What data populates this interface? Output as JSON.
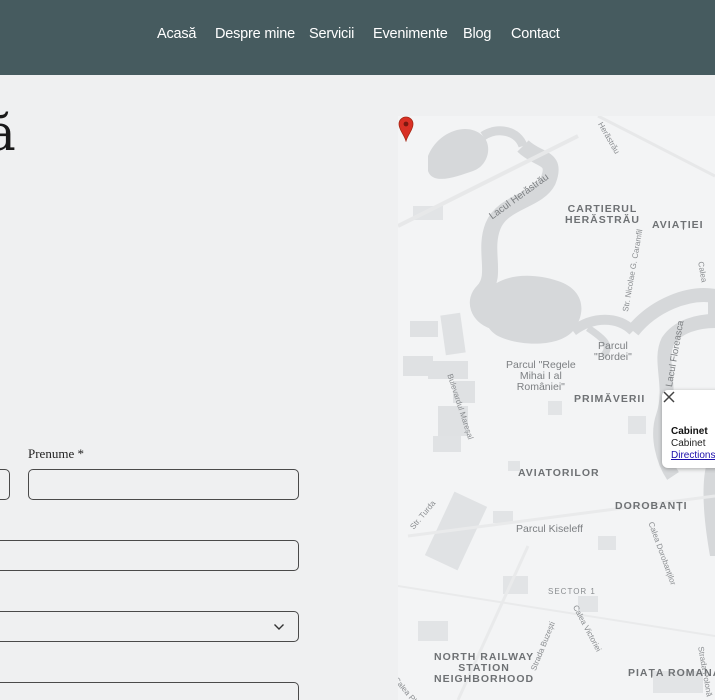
{
  "nav": {
    "items": [
      {
        "label": "Acasă"
      },
      {
        "label": "Despre mine"
      },
      {
        "label": "Servicii"
      },
      {
        "label": "Evenimente"
      },
      {
        "label": "Blog"
      },
      {
        "label": "Contact"
      }
    ]
  },
  "heading": {
    "visible_fragment": "ă"
  },
  "form": {
    "prenume_label": "Prenume *",
    "prenume_value": "",
    "select_chevron_icon": "chevron-down-icon"
  },
  "map": {
    "labels": {
      "cartierul": "CARTIERUL\nHERĂSTRĂU",
      "aviatiei": "AVIAȚIEI",
      "lacul_herastrau": "Lacul Herăstrău",
      "parcul_bordei": "Parcul\n\"Bordei\"",
      "parcul_regele": "Parcul \"Regele\nMihai I al\nRomâniei\"",
      "primaverii": "PRIMĂVERII",
      "aviatorilor": "AVIATORILOR",
      "dorobanti": "DOROBANȚI",
      "parcul_kiseleff": "Parcul Kiseleff",
      "sector1": "SECTOR 1",
      "north_railway": "NORTH RAILWAY\nSTATION\nNEIGHBORHOOD",
      "piata_romana": "PIAȚA ROMANA",
      "str_turda": "Str. Turda",
      "lacul_floreasca": "Lacul Floreasca",
      "str_caramfil": "Str. Nicolae G. Caramfil",
      "bd_maresal": "Bulevardul Mareșal",
      "calea_dorobantilor": "Calea Dorobanților",
      "calea_victoriei": "Calea Victoriei",
      "strada_buzesti": "Strada Buzești",
      "strada_polona": "Strada Polonă",
      "calea_plevnei": "Calea Plevnei",
      "calea": "Calea",
      "herastrau_top": "Herăstrău"
    },
    "popup": {
      "title": "Cabinet",
      "subtitle": "Cabinet",
      "link": "Directions",
      "close_icon": "close-icon"
    },
    "pin_icon": "map-pin-icon",
    "colors": {
      "water": "#d6d8da",
      "land": "#f3f4f5",
      "buildings": "#dfe1e3",
      "pin": "#d93025"
    }
  }
}
